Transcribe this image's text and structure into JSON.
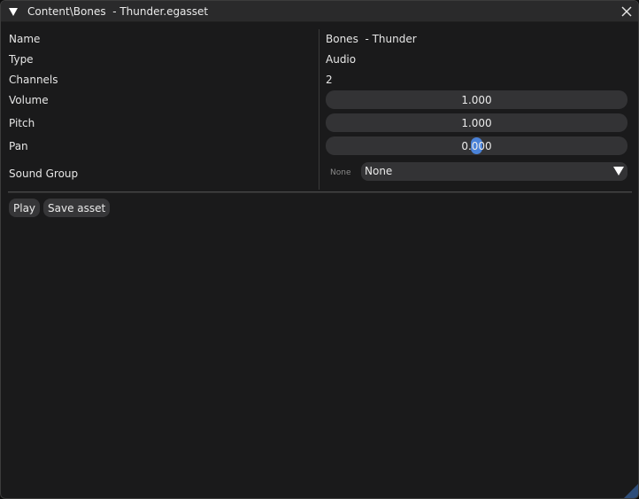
{
  "window": {
    "title": "Content\\Bones  - Thunder.egasset",
    "icons": {
      "collapse": "triangle-down-icon",
      "close": "close-icon",
      "resize": "resize-grip-icon"
    }
  },
  "properties": {
    "name": {
      "label": "Name",
      "value": "Bones  - Thunder"
    },
    "type": {
      "label": "Type",
      "value": "Audio"
    },
    "channels": {
      "label": "Channels",
      "value": "2"
    },
    "volume": {
      "label": "Volume",
      "value": "1.000"
    },
    "pitch": {
      "label": "Pitch",
      "value": "1.000"
    },
    "pan": {
      "label": "Pan",
      "value": "0.000"
    },
    "sound_group": {
      "label": "Sound Group",
      "hint": "None",
      "selected": "None"
    }
  },
  "actions": {
    "play": "Play",
    "save": "Save asset"
  },
  "colors": {
    "background": "#1a1a1b",
    "titlebar": "#2a2a2b",
    "field": "#333335",
    "accent": "#4a82d8",
    "text": "#e6e6e6"
  }
}
